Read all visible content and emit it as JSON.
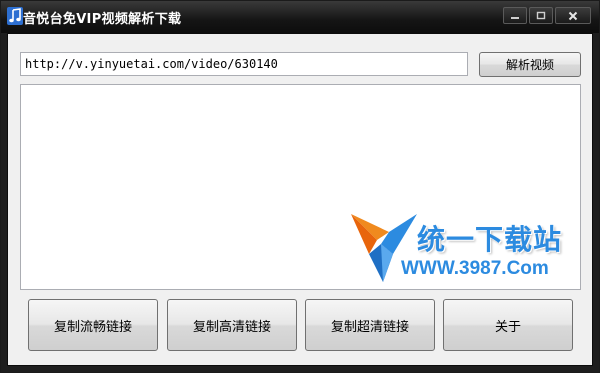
{
  "window": {
    "title": "音悦台免VIP视频解析下载",
    "icon": "music-note-icon",
    "controls": [
      "minimize-icon",
      "maximize-icon",
      "close-icon"
    ]
  },
  "url_input": {
    "value": "http://v.yinyuetai.com/video/630140",
    "placeholder": ""
  },
  "parse_button": {
    "label": "解析视频"
  },
  "output": {
    "watermark": {
      "title": "统一下载站",
      "url": "WWW.3987.Com"
    }
  },
  "buttons": {
    "copy_smooth": "复制流畅链接",
    "copy_hd": "复制高清链接",
    "copy_super": "复制超清链接",
    "about": "关于"
  },
  "colors": {
    "titlebar": "#151515",
    "client_bg": "#f0f0f0",
    "watermark_blue": "#2c8be0",
    "watermark_orange": "#e8650c"
  }
}
